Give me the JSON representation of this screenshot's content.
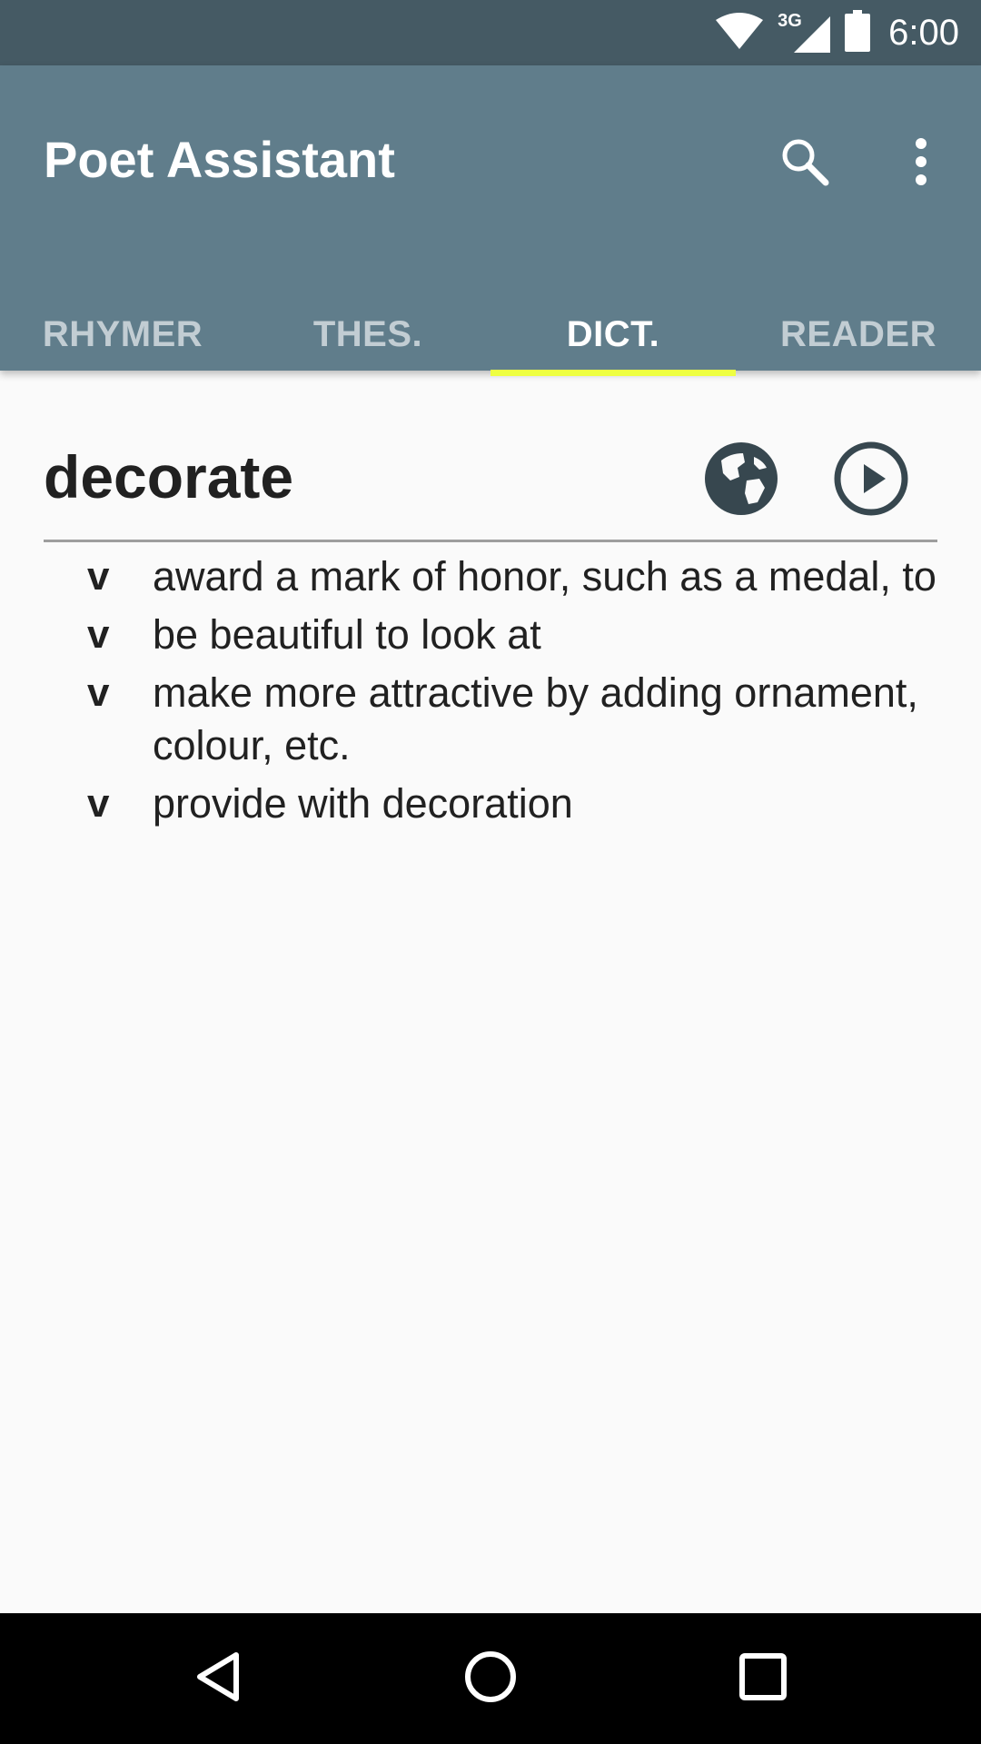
{
  "status_bar": {
    "network": "3G",
    "time": "6:00",
    "icons": [
      "wifi-icon",
      "cell-signal-icon",
      "battery-icon"
    ]
  },
  "app_bar": {
    "title": "Poet Assistant",
    "actions": [
      "search-icon",
      "overflow-menu-icon"
    ]
  },
  "tabs": [
    {
      "label": "RHYMER",
      "active": false
    },
    {
      "label": "THES.",
      "active": false
    },
    {
      "label": "DICT.",
      "active": true
    },
    {
      "label": "READER",
      "active": false
    }
  ],
  "dictionary": {
    "word": "decorate",
    "actions": [
      "web-search-icon",
      "play-icon"
    ],
    "definitions": [
      {
        "pos": "v",
        "text": "award a mark of honor, such as a medal, to"
      },
      {
        "pos": "v",
        "text": "be beautiful to look at"
      },
      {
        "pos": "v",
        "text": "make more attractive by adding ornament, colour, etc."
      },
      {
        "pos": "v",
        "text": "provide with decoration"
      }
    ]
  },
  "nav_bar": {
    "buttons": [
      "back-icon",
      "home-icon",
      "recents-icon"
    ]
  },
  "colors": {
    "status_bar": "#455a64",
    "app_bar": "#607d8b",
    "tab_indicator": "#eeff41",
    "background": "#fafafa",
    "nav_bar": "#000000"
  }
}
